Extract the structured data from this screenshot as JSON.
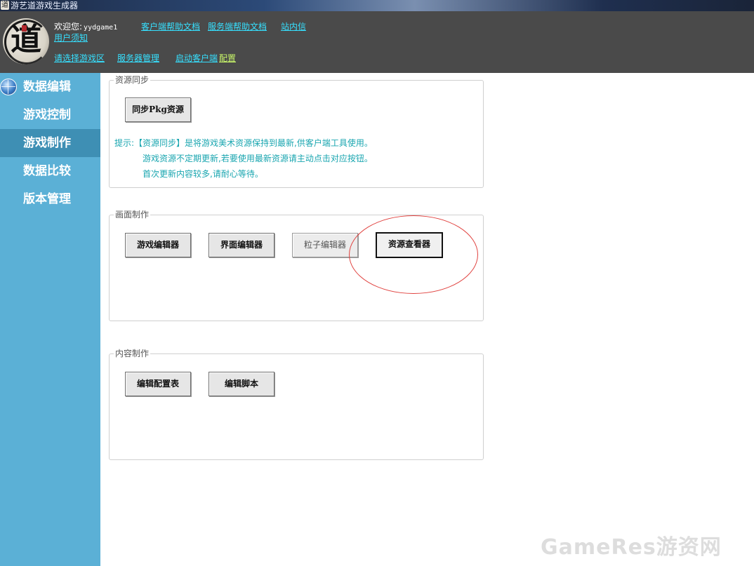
{
  "window": {
    "title": "游艺道游戏生成器"
  },
  "header": {
    "welcome_label": "欢迎您:",
    "username": "yydgame1",
    "links": {
      "client_help": "客户端帮助文档",
      "server_help": "服务端帮助文档",
      "inbox": "站内信",
      "user_notice": "用户须知",
      "select_zone": "请选择游戏区",
      "server_manage": "服务器管理",
      "launch_client": "启动客户端",
      "config": "配置"
    },
    "logo_glyph": "道"
  },
  "sidebar": {
    "items": [
      {
        "label": "数据编辑",
        "icon": "globe-icon"
      },
      {
        "label": "游戏控制"
      },
      {
        "label": "游戏制作",
        "active": true
      },
      {
        "label": "数据比较"
      },
      {
        "label": "版本管理"
      }
    ]
  },
  "sections": {
    "resource_sync": {
      "legend": "资源同步",
      "button": "同步Pkg资源",
      "tip_line1": "提示:【资源同步】是将游戏美术资源保持到最新,供客户端工具使用。",
      "tip_line2": "游戏资源不定期更新,若要使用最新资源请主动点击对应按钮。",
      "tip_line3": "首次更新内容较多,请耐心等待。"
    },
    "scene_make": {
      "legend": "画面制作",
      "buttons": [
        "游戏编辑器",
        "界面编辑器",
        "粒子编辑器",
        "资源查看器"
      ]
    },
    "content_make": {
      "legend": "内容制作",
      "buttons": [
        "编辑配置表",
        "编辑脚本"
      ]
    }
  },
  "watermark": "GameRes游资网",
  "colors": {
    "sidebar_bg": "#5bb0d6",
    "sidebar_active": "#3e8fb4",
    "header_bg": "#4a4a4a",
    "link": "#36e0ff",
    "tip_text": "#1aa6b0",
    "annotation": "#e0413e"
  }
}
